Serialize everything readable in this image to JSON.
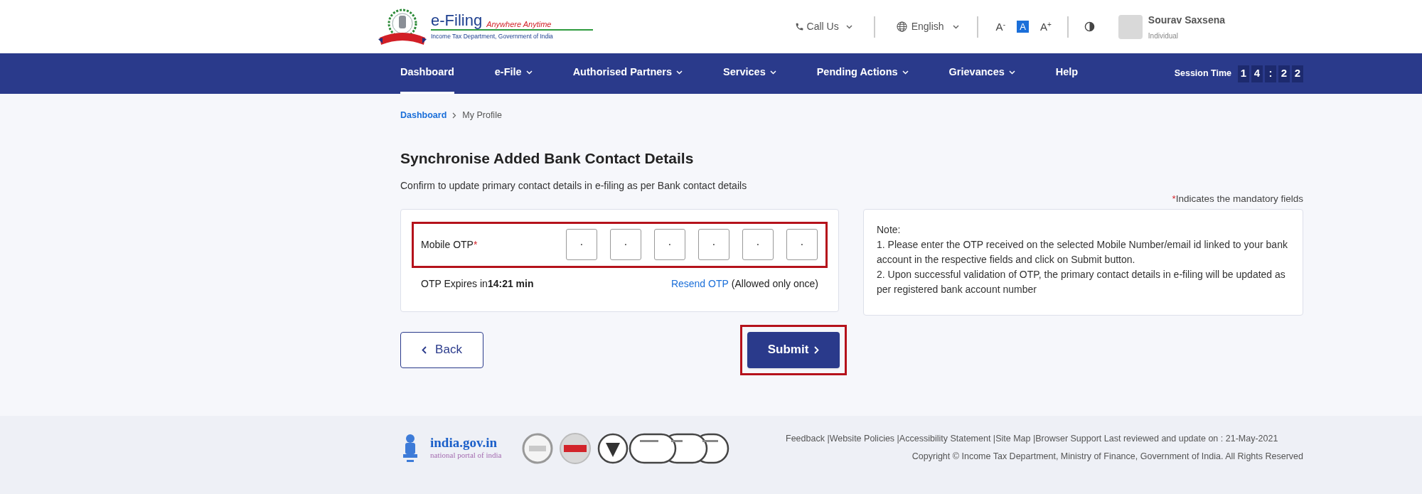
{
  "header": {
    "logo": {
      "title": "e-Filing",
      "tagline": "Anywhere Anytime",
      "subtitle": "Income Tax Department, Government of India"
    },
    "call_us": "Call Us",
    "language": "English",
    "font_controls": [
      {
        "label": "A",
        "sup": "-",
        "selected": false
      },
      {
        "label": "A",
        "selected": true
      },
      {
        "label": "A",
        "sup": "+",
        "selected": false
      }
    ],
    "user": {
      "name": "Sourav Saxsena",
      "role": "Individual"
    }
  },
  "nav": {
    "items": [
      {
        "label": "Dashboard",
        "has_dropdown": false,
        "selected": true
      },
      {
        "label": "e-File",
        "has_dropdown": true,
        "selected": false
      },
      {
        "label": "Authorised Partners",
        "has_dropdown": true,
        "selected": false
      },
      {
        "label": "Services",
        "has_dropdown": true,
        "selected": false
      },
      {
        "label": "Pending Actions",
        "has_dropdown": true,
        "selected": false
      },
      {
        "label": "Grievances",
        "has_dropdown": true,
        "selected": false
      },
      {
        "label": "Help",
        "has_dropdown": false,
        "selected": false
      }
    ],
    "session": {
      "label": "Session Time",
      "digits": [
        "1",
        "4",
        ":",
        "2",
        "2"
      ]
    }
  },
  "breadcrumb": [
    {
      "label": "Dashboard",
      "link": true
    },
    {
      "label": "My Profile",
      "link": false
    }
  ],
  "title": "Synchronise Added Bank Contact Details",
  "subtitle": "Confirm to update primary contact details in e-filing as per Bank contact details",
  "mandatory_note": {
    "mark": "*",
    "text": "Indicates the mandatory fields"
  },
  "otp": {
    "label": "Mobile OTP",
    "required_mark": "*",
    "highlighted": true,
    "boxes": [
      {
        "placeholder": "·"
      },
      {
        "placeholder": "·"
      },
      {
        "placeholder": "·"
      },
      {
        "placeholder": "·"
      },
      {
        "placeholder": "·"
      },
      {
        "placeholder": "·"
      }
    ],
    "expiry_label": "OTP Expires in",
    "expiry_time": "14:21 min",
    "resend": "Resend OTP",
    "resend_note": "(Allowed only once)"
  },
  "note": {
    "heading": "Note:",
    "lines": [
      "1. Please enter the OTP received on the selected Mobile Number/email id linked to your bank account in the respective fields and click on Submit button.",
      "2. Upon successful validation of OTP, the primary contact details in e-filing will be updated as per registered bank account number"
    ]
  },
  "buttons": {
    "back": "Back",
    "submit": "Submit",
    "submit_highlighted": true
  },
  "footer": {
    "portal": {
      "name": "india.gov.in",
      "tagline": "national portal of india"
    },
    "links": [
      "Feedback",
      "Website Policies",
      "Accessibility Statement",
      "Site Map",
      "Browser Support"
    ],
    "separator": "|",
    "reviewed": "Last reviewed and update on : 21-May-2021",
    "copyright": "Copyright © Income Tax Department, Ministry of Finance, Government of India. All Rights Reserved"
  }
}
